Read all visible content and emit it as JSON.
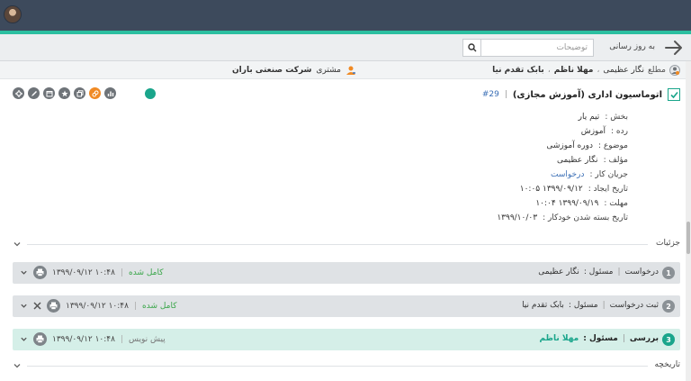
{
  "toolbar": {
    "refresh_label": "به روز رسانی",
    "search_placeholder": "توضیحات",
    "back_icon": "arrow-right-icon",
    "search_icon": "search-icon"
  },
  "info": {
    "informed_label": "مطلع",
    "informed": [
      "نگار عظیمی",
      "مهلا ناظم",
      "بابک تقدم نیا"
    ],
    "customer_label": "مشتری",
    "customer": "شرکت صنعتی باران"
  },
  "ticket": {
    "title": "اتوماسیون اداری (آموزش مجازی)",
    "number": "#29",
    "status_color": "#1aa58b"
  },
  "props": [
    {
      "key": "بخش :",
      "value": "تیم یار"
    },
    {
      "key": "رده :",
      "value": "آموزش"
    },
    {
      "key": "موضوع :",
      "value": "دوره آموزشی"
    },
    {
      "key": "مؤلف :",
      "value": "نگار عظیمی"
    },
    {
      "key": "جریان کار :",
      "value": "درخواست"
    },
    {
      "key": "تاریخ ایجاد :",
      "value": "۱۳۹۹/۰۹/۱۲ ۱۰:۰۵"
    },
    {
      "key": "مهلت :",
      "value": "۱۳۹۹/۰۹/۱۹ ۱۰:۰۴"
    },
    {
      "key": "تاریخ بسته شدن خودکار :",
      "value": "۱۳۹۹/۱۰/۰۳"
    }
  ],
  "sections": {
    "details": "جزئیات",
    "history": "تاریخچه"
  },
  "steps": [
    {
      "num": "1",
      "name": "درخواست",
      "owner_label": "مسئول :",
      "owner": "نگار عظیمی",
      "status": "کامل شده",
      "time": "۱۳۹۹/۰۹/۱۲ ۱۰:۴۸"
    },
    {
      "num": "2",
      "name": "ثبت درخواست",
      "owner_label": "مسئول :",
      "owner": "بابک تقدم نیا",
      "status": "کامل شده",
      "time": "۱۳۹۹/۰۹/۱۲ ۱۰:۴۸"
    },
    {
      "num": "3",
      "name": "بررسی",
      "owner_label": "مسئول :",
      "owner": "مهلا ناظم",
      "status": "پیش نویس",
      "time": "۱۳۹۹/۰۹/۱۲ ۱۰:۴۸"
    }
  ]
}
